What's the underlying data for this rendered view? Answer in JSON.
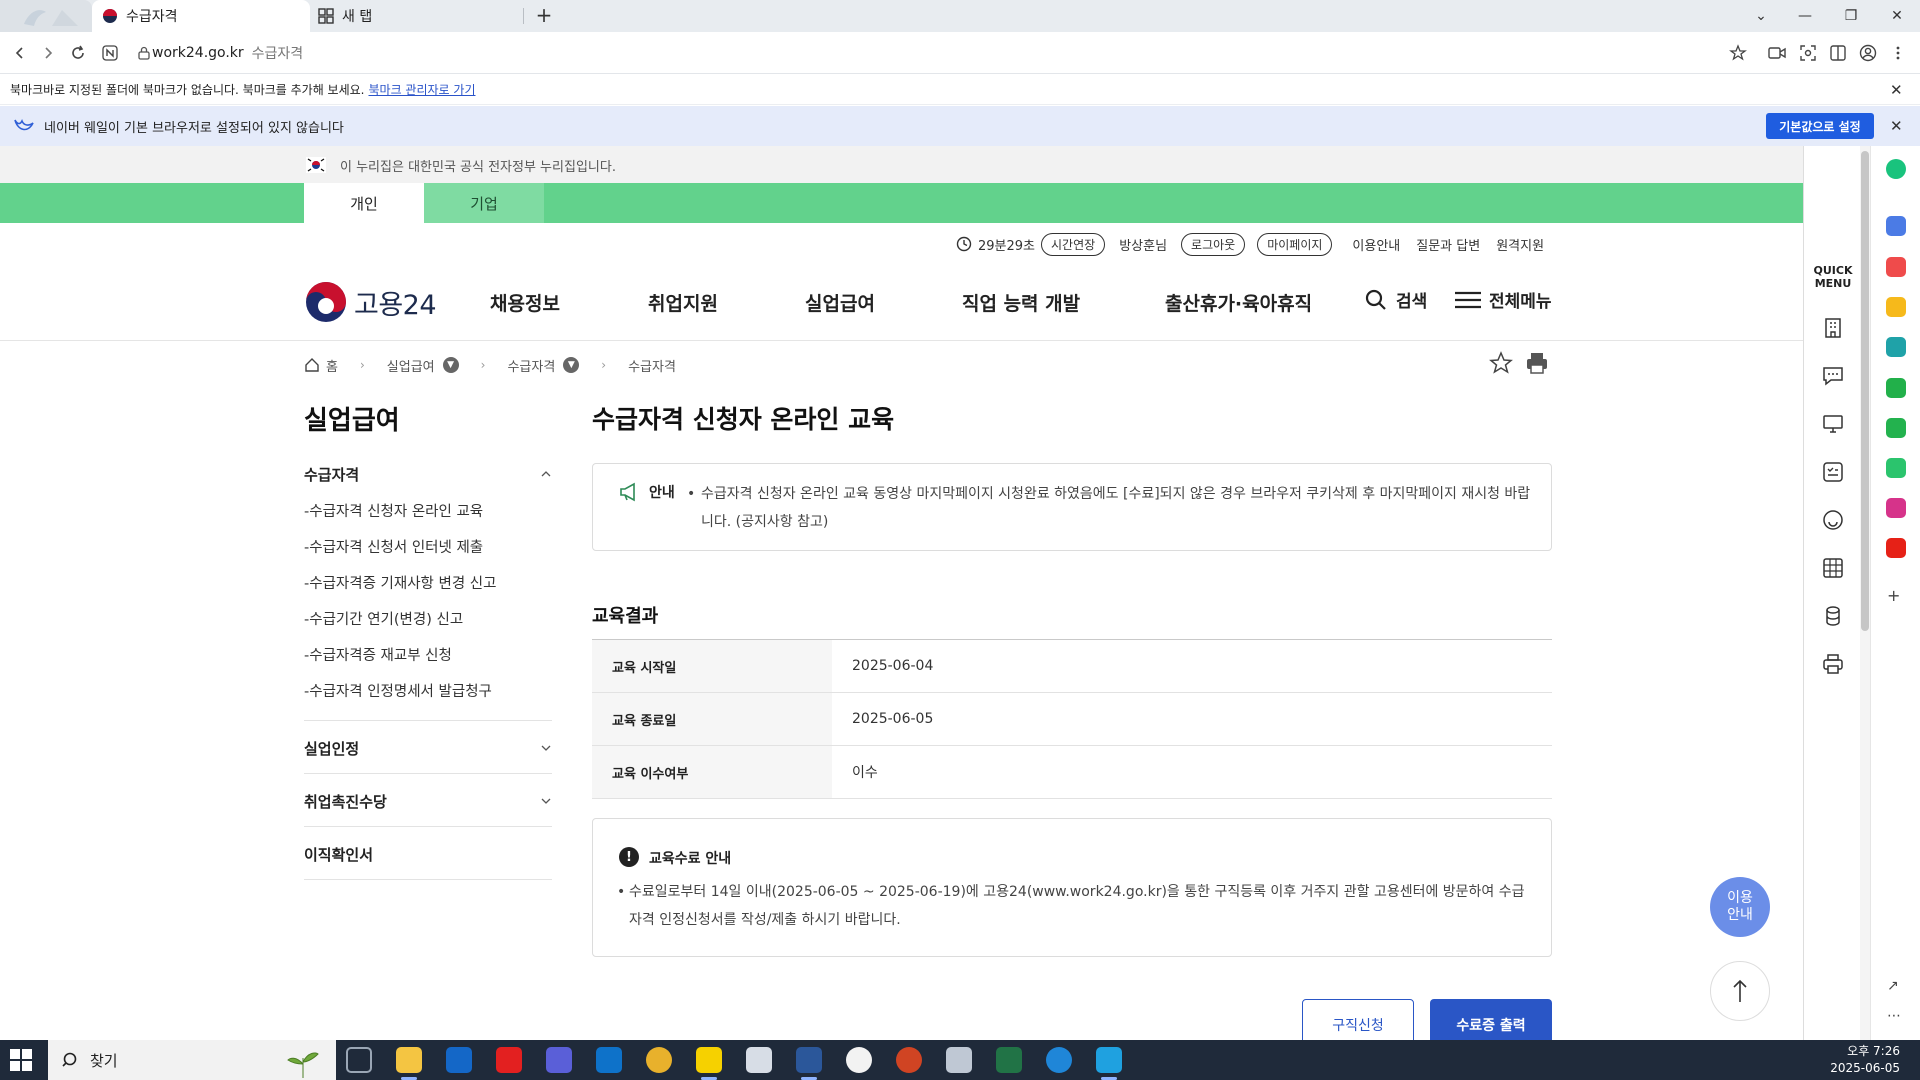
{
  "browser": {
    "active_tab_title": "수급자격",
    "new_tab_title": "새 탭",
    "url_host": "work24.go.kr",
    "url_title": "수급자격",
    "bookmark_message": "북마크바로 지정된 폴더에 북마크가 없습니다. 북마크를 추가해 보세요.",
    "bookmark_link": "북마크 관리자로 가기",
    "default_message": "네이버 웨일이 기본 브라우저로 설정되어 있지 않습니다",
    "default_button": "기본값으로 설정"
  },
  "site": {
    "gov_notice": "이 누리집은 대한민국 공식 전자정부 누리집입니다.",
    "tabs": [
      "개인",
      "기업"
    ],
    "util": {
      "timer": "29분29초",
      "extend": "시간연장",
      "user": "방상훈님",
      "logout": "로그아웃",
      "mypage": "마이페이지",
      "links": [
        "이용안내",
        "질문과 답변",
        "원격지원"
      ]
    },
    "logo_text": "고용24",
    "gnb": [
      "채용정보",
      "취업지원",
      "실업급여",
      "직업 능력 개발",
      "출산휴가·육아휴직"
    ],
    "search_label": "검색",
    "menu_label": "전체메뉴",
    "breadcrumb": [
      "홈",
      "실업급여",
      "수급자격",
      "수급자격"
    ]
  },
  "lnb": {
    "title": "실업급여",
    "group1": "수급자격",
    "sub_items": [
      "-수급자격 신청자 온라인 교육",
      "-수급자격 신청서 인터넷 제출",
      "-수급자격증 기재사항 변경 신고",
      "-수급기간 연기(변경) 신고",
      "-수급자격증 재교부 신청",
      "-수급자격 인정명세서 발급청구"
    ],
    "groups": [
      "실업인정",
      "취업촉진수당",
      "이직확인서"
    ]
  },
  "main": {
    "title": "수급자격 신청자 온라인 교육",
    "notice_label": "안내",
    "notice_text": "수급자격 신청자 온라인 교육 동영상 마지막페이지 시청완료 하였음에도 [수료]되지 않은 경우 브라우저 쿠키삭제 후 마지막페이지 재시청 바랍니다. (공지사항 참고)",
    "section_title": "교육결과",
    "rows": [
      {
        "label": "교육 시작일",
        "value": "2025-06-04"
      },
      {
        "label": "교육 종료일",
        "value": "2025-06-05"
      },
      {
        "label": "교육 이수여부",
        "value": "이수"
      }
    ],
    "complete_title": "교육수료 안내",
    "complete_text": "수료일로부터 14일 이내(2025-06-05 ~ 2025-06-19)에 고용24(www.work24.go.kr)을 통한 구직등록 이후 거주지 관할 고용센터에 방문하여 수급자격 인정신청서를 작성/제출 하시기 바랍니다.",
    "job_button": "구직신청",
    "cert_button": "수료증 출력"
  },
  "floats": {
    "info": "이용\n안내"
  },
  "quickmenu": {
    "title": "QUICK\nMENU"
  },
  "taskbar": {
    "search_placeholder": "찾기",
    "time": "오후 7:26",
    "date": "2025-06-05"
  },
  "colors": {
    "green_band": "#62d28c",
    "primary_blue": "#2a56c6",
    "whale_blue": "#1f5de0"
  }
}
